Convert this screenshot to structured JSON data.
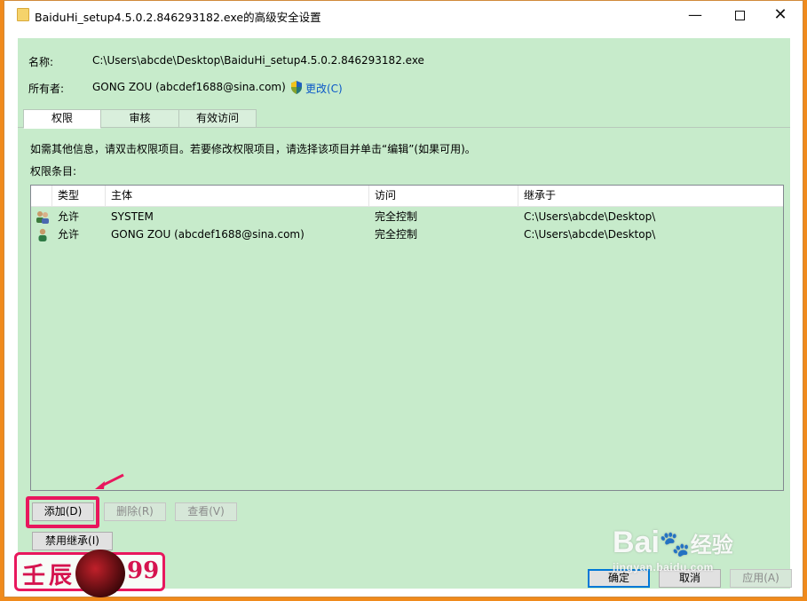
{
  "window": {
    "title": "BaiduHi_setup4.5.0.2.846293182.exe的高级安全设置",
    "minimize": "—",
    "close": "✕"
  },
  "info": {
    "name_label": "名称:",
    "name_value": "C:\\Users\\abcde\\Desktop\\BaiduHi_setup4.5.0.2.846293182.exe",
    "owner_label": "所有者:",
    "owner_value": "GONG ZOU (abcdef1688@sina.com)",
    "change_link": "更改(C)"
  },
  "tabs": [
    {
      "label": "权限",
      "active": true
    },
    {
      "label": "审核",
      "active": false
    },
    {
      "label": "有效访问",
      "active": false
    }
  ],
  "instructions": "如需其他信息，请双击权限项目。若要修改权限项目，请选择该项目并单击“编辑”(如果可用)。",
  "entries_label": "权限条目:",
  "table": {
    "columns": [
      "类型",
      "主体",
      "访问",
      "继承于"
    ],
    "rows": [
      {
        "icon": "group-users-icon",
        "type": "允许",
        "principal": "SYSTEM",
        "access": "完全控制",
        "inherited": "C:\\Users\\abcde\\Desktop\\"
      },
      {
        "icon": "user-icon",
        "type": "允许",
        "principal": "GONG ZOU (abcdef1688@sina.com)",
        "access": "完全控制",
        "inherited": "C:\\Users\\abcde\\Desktop\\"
      }
    ]
  },
  "buttons": {
    "add": "添加(D)",
    "remove": "删除(R)",
    "view": "查看(V)",
    "disable_inheritance": "禁用继承(I)",
    "ok": "确定",
    "cancel": "取消",
    "apply": "应用(A)"
  },
  "watermark": {
    "left_char1": "壬",
    "left_char2": "辰",
    "left_number": "99",
    "baidu_logo": "Bai",
    "baidu_logo_end": "经验",
    "baidu_url": "jingyan.baidu.com"
  },
  "colors": {
    "content_bg": "#c7ebcb",
    "highlight": "#e8175d",
    "link": "#0a58c8"
  }
}
